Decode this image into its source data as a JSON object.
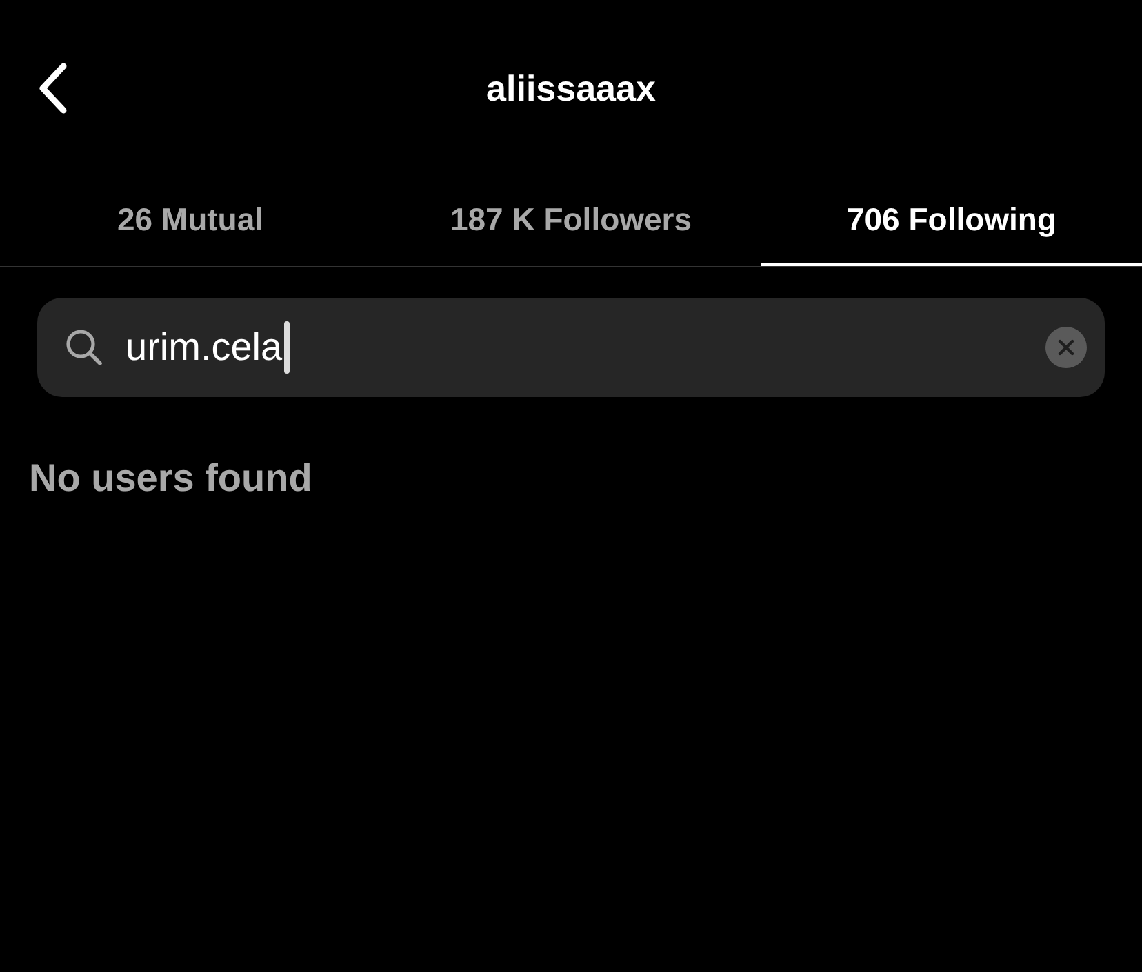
{
  "header": {
    "title": "aliissaaax"
  },
  "tabs": [
    {
      "label": "26 Mutual",
      "selected": false
    },
    {
      "label": "187 K Followers",
      "selected": false
    },
    {
      "label": "706 Following",
      "selected": true
    }
  ],
  "search": {
    "value": "urim.cela"
  },
  "message": "No users found"
}
